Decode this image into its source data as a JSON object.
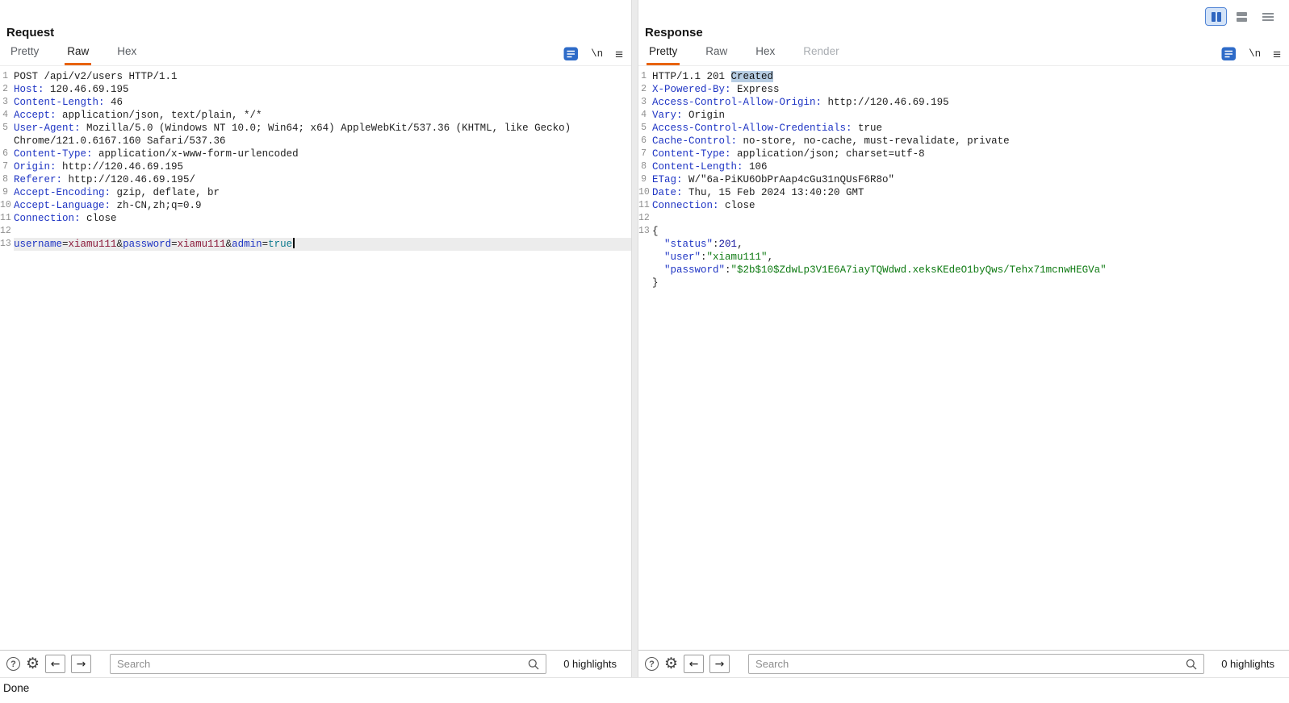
{
  "status_bar": {
    "text": "Done"
  },
  "icons": {
    "newline": "\\n",
    "menu": "≡",
    "help": "?",
    "settings": "⚙",
    "arrow_left": "←",
    "arrow_right": "→"
  },
  "colors": {
    "accent_orange": "#e8630c",
    "header_name_blue": "#1f35c4",
    "json_string_green": "#0e7a12",
    "selection_blue": "#b7cde3",
    "active_layout_blue": "#d3e3f8"
  },
  "request": {
    "title": "Request",
    "tabs": [
      {
        "label": "Pretty",
        "state": "normal"
      },
      {
        "label": "Raw",
        "state": "active"
      },
      {
        "label": "Hex",
        "state": "normal"
      }
    ],
    "search": {
      "placeholder": "Search",
      "highlights_label": "0 highlights"
    },
    "lines": [
      {
        "n": "1",
        "segs": [
          {
            "t": "POST /api/v2/users HTTP/1.1",
            "c": "pl"
          }
        ]
      },
      {
        "n": "2",
        "segs": [
          {
            "t": "Host:",
            "c": "hn"
          },
          {
            "t": " 120.46.69.195",
            "c": "pl"
          }
        ]
      },
      {
        "n": "3",
        "segs": [
          {
            "t": "Content-Length:",
            "c": "hn"
          },
          {
            "t": " 46",
            "c": "pl"
          }
        ]
      },
      {
        "n": "4",
        "segs": [
          {
            "t": "Accept:",
            "c": "hn"
          },
          {
            "t": " application/json, text/plain, */*",
            "c": "pl"
          }
        ]
      },
      {
        "n": "5",
        "segs": [
          {
            "t": "User-Agent:",
            "c": "hn"
          },
          {
            "t": " Mozilla/5.0 (Windows NT 10.0; Win64; x64) AppleWebKit/537.36 (KHTML, like Gecko) Chrome/121.0.6167.160 Safari/537.36",
            "c": "pl"
          }
        ]
      },
      {
        "n": "6",
        "segs": [
          {
            "t": "Content-Type:",
            "c": "hn"
          },
          {
            "t": " application/x-www-form-urlencoded",
            "c": "pl"
          }
        ]
      },
      {
        "n": "7",
        "segs": [
          {
            "t": "Origin:",
            "c": "hn"
          },
          {
            "t": " http://120.46.69.195",
            "c": "pl"
          }
        ]
      },
      {
        "n": "8",
        "segs": [
          {
            "t": "Referer:",
            "c": "hn"
          },
          {
            "t": " http://120.46.69.195/",
            "c": "pl"
          }
        ]
      },
      {
        "n": "9",
        "segs": [
          {
            "t": "Accept-Encoding:",
            "c": "hn"
          },
          {
            "t": " gzip, deflate, br",
            "c": "pl"
          }
        ]
      },
      {
        "n": "10",
        "segs": [
          {
            "t": "Accept-Language:",
            "c": "hn"
          },
          {
            "t": " zh-CN,zh;q=0.9",
            "c": "pl"
          }
        ]
      },
      {
        "n": "11",
        "segs": [
          {
            "t": "Connection:",
            "c": "hn"
          },
          {
            "t": " close",
            "c": "pl"
          }
        ]
      },
      {
        "n": "12",
        "segs": []
      },
      {
        "n": "13",
        "hl": true,
        "cursor": true,
        "segs": [
          {
            "t": "username",
            "c": "pn"
          },
          {
            "t": "=",
            "c": "pl"
          },
          {
            "t": "xiamu111",
            "c": "pv"
          },
          {
            "t": "&",
            "c": "pl"
          },
          {
            "t": "password",
            "c": "pn"
          },
          {
            "t": "=",
            "c": "pl"
          },
          {
            "t": "xiamu111",
            "c": "pv"
          },
          {
            "t": "&",
            "c": "pl"
          },
          {
            "t": "admin",
            "c": "pn"
          },
          {
            "t": "=",
            "c": "pl"
          },
          {
            "t": "true",
            "c": "bool"
          }
        ]
      }
    ]
  },
  "response": {
    "title": "Response",
    "tabs": [
      {
        "label": "Pretty",
        "state": "active"
      },
      {
        "label": "Raw",
        "state": "normal"
      },
      {
        "label": "Hex",
        "state": "normal"
      },
      {
        "label": "Render",
        "state": "disabled"
      }
    ],
    "search": {
      "placeholder": "Search",
      "highlights_label": "0 highlights"
    },
    "lines": [
      {
        "n": "1",
        "segs": [
          {
            "t": "HTTP/1.1 201 ",
            "c": "pl"
          },
          {
            "t": "Created",
            "c": "sel"
          }
        ]
      },
      {
        "n": "2",
        "segs": [
          {
            "t": "X-Powered-By:",
            "c": "hn"
          },
          {
            "t": " Express",
            "c": "pl"
          }
        ]
      },
      {
        "n": "3",
        "segs": [
          {
            "t": "Access-Control-Allow-Origin:",
            "c": "hn"
          },
          {
            "t": " http://120.46.69.195",
            "c": "pl"
          }
        ]
      },
      {
        "n": "4",
        "segs": [
          {
            "t": "Vary:",
            "c": "hn"
          },
          {
            "t": " Origin",
            "c": "pl"
          }
        ]
      },
      {
        "n": "5",
        "segs": [
          {
            "t": "Access-Control-Allow-Credentials:",
            "c": "hn"
          },
          {
            "t": " true",
            "c": "pl"
          }
        ]
      },
      {
        "n": "6",
        "segs": [
          {
            "t": "Cache-Control:",
            "c": "hn"
          },
          {
            "t": " no-store, no-cache, must-revalidate, private",
            "c": "pl"
          }
        ]
      },
      {
        "n": "7",
        "segs": [
          {
            "t": "Content-Type:",
            "c": "hn"
          },
          {
            "t": " application/json; charset=utf-8",
            "c": "pl"
          }
        ]
      },
      {
        "n": "8",
        "segs": [
          {
            "t": "Content-Length:",
            "c": "hn"
          },
          {
            "t": " 106",
            "c": "pl"
          }
        ]
      },
      {
        "n": "9",
        "segs": [
          {
            "t": "ETag:",
            "c": "hn"
          },
          {
            "t": " W/\"6a-PiKU6ObPrAap4cGu31nQUsF6R8o\"",
            "c": "pl"
          }
        ]
      },
      {
        "n": "10",
        "segs": [
          {
            "t": "Date:",
            "c": "hn"
          },
          {
            "t": " Thu, 15 Feb 2024 13:40:20 GMT",
            "c": "pl"
          }
        ]
      },
      {
        "n": "11",
        "segs": [
          {
            "t": "Connection:",
            "c": "hn"
          },
          {
            "t": " close",
            "c": "pl"
          }
        ]
      },
      {
        "n": "12",
        "segs": []
      },
      {
        "n": "13",
        "segs": [
          {
            "t": "{",
            "c": "pl"
          }
        ]
      },
      {
        "segs": [
          {
            "t": "  ",
            "c": "pl"
          },
          {
            "t": "\"status\"",
            "c": "jk"
          },
          {
            "t": ":",
            "c": "pl"
          },
          {
            "t": "201",
            "c": "jn"
          },
          {
            "t": ",",
            "c": "pl"
          }
        ]
      },
      {
        "segs": [
          {
            "t": "  ",
            "c": "pl"
          },
          {
            "t": "\"user\"",
            "c": "jk"
          },
          {
            "t": ":",
            "c": "pl"
          },
          {
            "t": "\"xiamu111\"",
            "c": "js"
          },
          {
            "t": ",",
            "c": "pl"
          }
        ]
      },
      {
        "segs": [
          {
            "t": "  ",
            "c": "pl"
          },
          {
            "t": "\"password\"",
            "c": "jk"
          },
          {
            "t": ":",
            "c": "pl"
          },
          {
            "t": "\"$2b$10$ZdwLp3V1E6A7iayTQWdwd.xeksKEdeO1byQws/Tehx71mcnwHEGVa\"",
            "c": "js"
          }
        ]
      },
      {
        "segs": [
          {
            "t": "}",
            "c": "pl"
          }
        ]
      }
    ]
  }
}
